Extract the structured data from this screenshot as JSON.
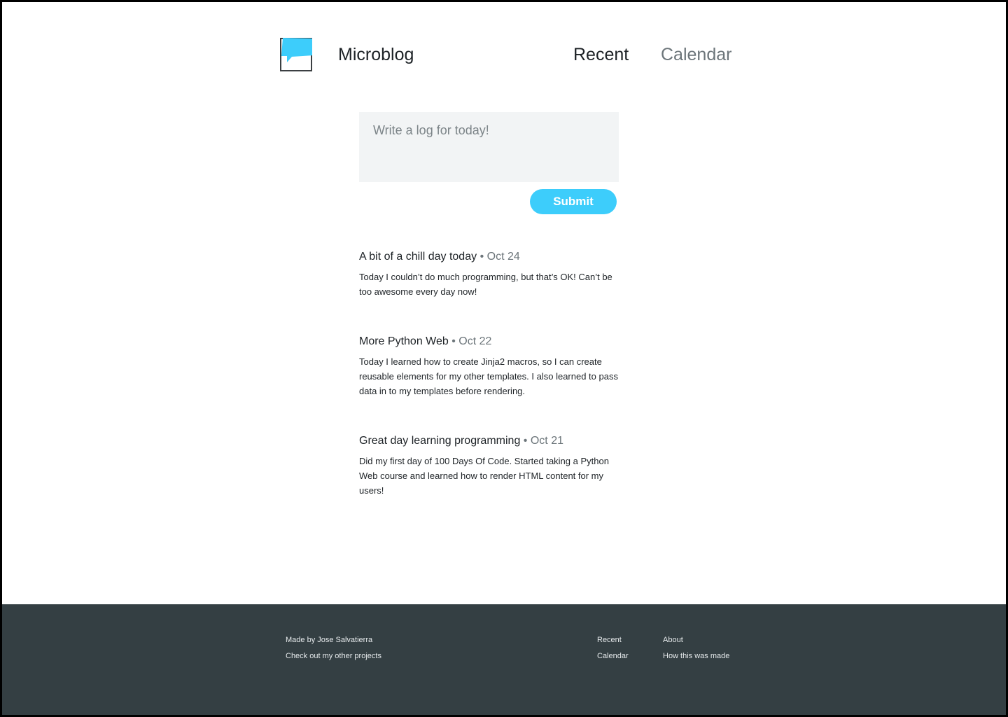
{
  "header": {
    "brand": "Microblog",
    "nav": {
      "recent": "Recent",
      "calendar": "Calendar"
    },
    "logo_icon": "speech-bubble-icon"
  },
  "composer": {
    "placeholder": "Write a log for today!",
    "value": "",
    "submit_label": "Submit"
  },
  "posts": [
    {
      "title": "A bit of a chill day today",
      "separator": "•",
      "date": "Oct 24",
      "body": "Today I couldn’t do much programming, but that’s OK! Can’t be too awesome every day now!"
    },
    {
      "title": "More Python Web",
      "separator": "•",
      "date": "Oct 22",
      "body": "Today I learned how to create Jinja2 macros, so I can create reusable elements for my other templates. I also learned to pass data in to my templates before rendering."
    },
    {
      "title": "Great day learning programming",
      "separator": "•",
      "date": "Oct 21",
      "body": "Did my first day of 100 Days Of Code. Started taking a Python Web course and learned how to render HTML content for my users!"
    }
  ],
  "footer": {
    "made_by": "Made by Jose Salvatierra",
    "other_projects": "Check out my other projects",
    "recent": "Recent",
    "calendar": "Calendar",
    "about": "About",
    "how_made": "How this was made"
  },
  "colors": {
    "accent": "#3dcdfb",
    "footer_bg": "#343f43",
    "composer_bg": "#f2f4f5",
    "muted_text": "#6c757a"
  }
}
